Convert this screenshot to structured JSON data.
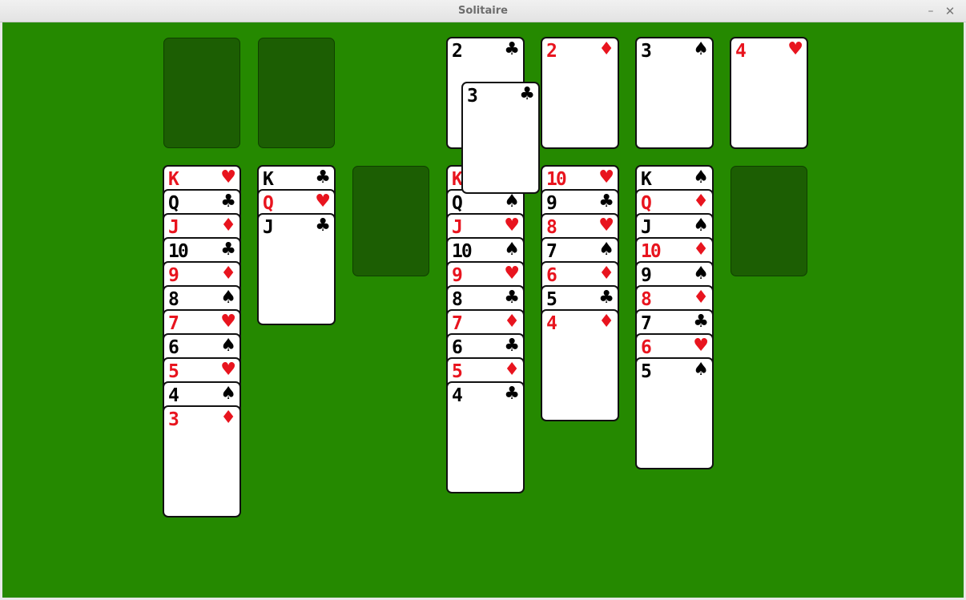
{
  "window": {
    "title": "Solitaire",
    "minimize_glyph": "–",
    "close_glyph": "✕"
  },
  "colors": {
    "felt": "#258900",
    "empty_slot": "#1c5e03",
    "red_suit": "#e8141e",
    "black_suit": "#000000"
  },
  "cells": [
    {
      "name": "free-cell-1",
      "card": null
    },
    {
      "name": "free-cell-2",
      "card": null
    }
  ],
  "foundations": [
    {
      "name": "foundation-clubs",
      "top": {
        "rank": "2",
        "suit": "♣",
        "color": "black"
      }
    },
    {
      "name": "foundation-diamonds",
      "top": {
        "rank": "2",
        "suit": "♦",
        "color": "red"
      }
    },
    {
      "name": "foundation-spades",
      "top": {
        "rank": "3",
        "suit": "♠",
        "color": "black"
      }
    },
    {
      "name": "foundation-hearts",
      "top": {
        "rank": "4",
        "suit": "♥",
        "color": "red"
      }
    }
  ],
  "tableau": [
    {
      "cards": [
        {
          "rank": "K",
          "suit": "♥",
          "color": "red"
        },
        {
          "rank": "Q",
          "suit": "♣",
          "color": "black"
        },
        {
          "rank": "J",
          "suit": "♦",
          "color": "red"
        },
        {
          "rank": "10",
          "suit": "♣",
          "color": "black"
        },
        {
          "rank": "9",
          "suit": "♦",
          "color": "red"
        },
        {
          "rank": "8",
          "suit": "♠",
          "color": "black"
        },
        {
          "rank": "7",
          "suit": "♥",
          "color": "red"
        },
        {
          "rank": "6",
          "suit": "♠",
          "color": "black"
        },
        {
          "rank": "5",
          "suit": "♥",
          "color": "red"
        },
        {
          "rank": "4",
          "suit": "♠",
          "color": "black"
        },
        {
          "rank": "3",
          "suit": "♦",
          "color": "red"
        }
      ]
    },
    {
      "cards": [
        {
          "rank": "K",
          "suit": "♣",
          "color": "black"
        },
        {
          "rank": "Q",
          "suit": "♥",
          "color": "red"
        },
        {
          "rank": "J",
          "suit": "♣",
          "color": "black"
        }
      ]
    },
    {
      "cards": []
    },
    {
      "cards": [
        {
          "rank": "K",
          "suit": "♥",
          "color": "red"
        },
        {
          "rank": "Q",
          "suit": "♠",
          "color": "black"
        },
        {
          "rank": "J",
          "suit": "♥",
          "color": "red"
        },
        {
          "rank": "10",
          "suit": "♠",
          "color": "black"
        },
        {
          "rank": "9",
          "suit": "♥",
          "color": "red"
        },
        {
          "rank": "8",
          "suit": "♣",
          "color": "black"
        },
        {
          "rank": "7",
          "suit": "♦",
          "color": "red"
        },
        {
          "rank": "6",
          "suit": "♣",
          "color": "black"
        },
        {
          "rank": "5",
          "suit": "♦",
          "color": "red"
        },
        {
          "rank": "4",
          "suit": "♣",
          "color": "black"
        }
      ]
    },
    {
      "cards": [
        {
          "rank": "10",
          "suit": "♥",
          "color": "red"
        },
        {
          "rank": "9",
          "suit": "♣",
          "color": "black"
        },
        {
          "rank": "8",
          "suit": "♥",
          "color": "red"
        },
        {
          "rank": "7",
          "suit": "♠",
          "color": "black"
        },
        {
          "rank": "6",
          "suit": "♦",
          "color": "red"
        },
        {
          "rank": "5",
          "suit": "♣",
          "color": "black"
        },
        {
          "rank": "4",
          "suit": "♦",
          "color": "red"
        }
      ]
    },
    {
      "cards": [
        {
          "rank": "K",
          "suit": "♠",
          "color": "black"
        },
        {
          "rank": "Q",
          "suit": "♦",
          "color": "red"
        },
        {
          "rank": "J",
          "suit": "♠",
          "color": "black"
        },
        {
          "rank": "10",
          "suit": "♦",
          "color": "red"
        },
        {
          "rank": "9",
          "suit": "♠",
          "color": "black"
        },
        {
          "rank": "8",
          "suit": "♦",
          "color": "red"
        },
        {
          "rank": "7",
          "suit": "♣",
          "color": "black"
        },
        {
          "rank": "6",
          "suit": "♥",
          "color": "red"
        },
        {
          "rank": "5",
          "suit": "♠",
          "color": "black"
        }
      ]
    },
    {
      "cards": []
    }
  ],
  "dragging": {
    "rank": "3",
    "suit": "♣",
    "color": "black"
  },
  "cursor_icon": "mouse-pointer-icon"
}
